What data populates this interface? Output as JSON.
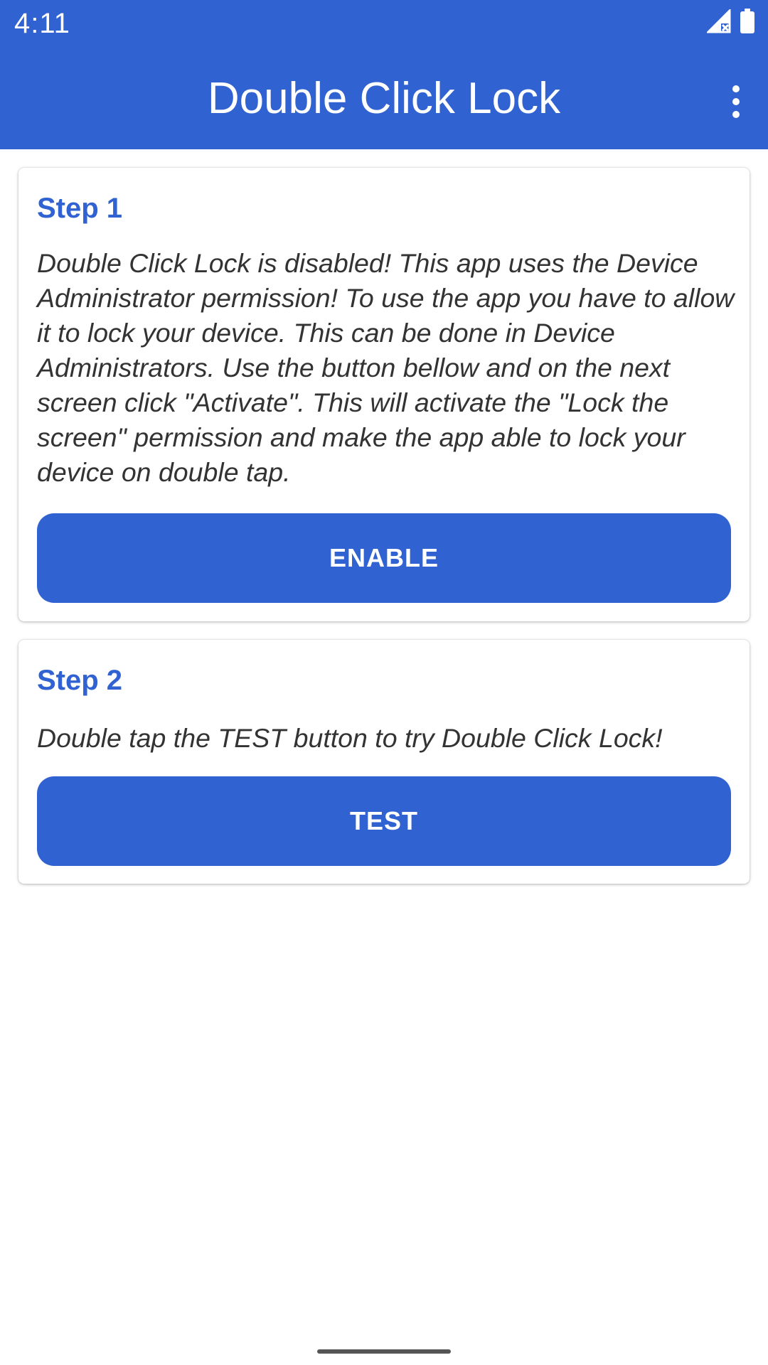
{
  "status_bar": {
    "time": "4:11",
    "icons": [
      "signal-icon",
      "battery-icon"
    ]
  },
  "app_bar": {
    "title": "Double Click Lock",
    "overflow_icon": "more-vert-icon"
  },
  "colors": {
    "primary": "#3162d2",
    "background": "#ffffff",
    "body_text": "#333333"
  },
  "steps": [
    {
      "title": "Step 1",
      "text": "Double Click Lock is disabled! This app uses the Device Administrator permission! To use the app you have to allow it to lock your device. This can be done in Device Administrators. Use the button bellow and on the next screen click \"Activate\". This will activate the \"Lock the screen\" permission and make the app able to lock your device on double tap.",
      "button_label": "ENABLE"
    },
    {
      "title": "Step 2",
      "text": "Double tap the TEST button to try Double Click Lock!",
      "button_label": "TEST"
    }
  ]
}
